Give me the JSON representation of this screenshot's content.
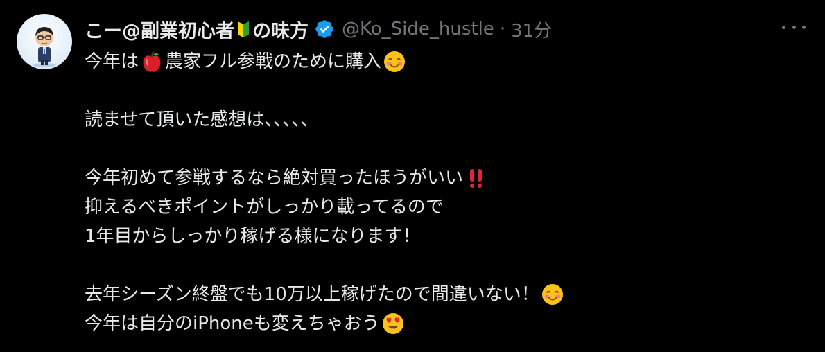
{
  "author": {
    "display_name": "こー@副業初心者",
    "name_suffix": "の味方",
    "handle": "@Ko_Side_hustle",
    "separator": "·",
    "time": "31分",
    "verified_icon": "verified-badge-icon",
    "beginner_icon": "beginner-mark-icon"
  },
  "tweet": {
    "line1_a": "今年は",
    "line1_b": "農家フル参戦のために購入",
    "line2": "読ませて頂いた感想は、、、、、",
    "line3": "今年初めて参戦するなら絶対買ったほうがいい",
    "line4": "抑えるべきポイントがしっかり載ってるので",
    "line5": "1年目からしっかり稼げる様になります！",
    "line6": "去年シーズン終盤でも10万以上稼げたので間違いない！",
    "line7": "今年は自分のiPhoneも変えちゃおう"
  },
  "colors": {
    "background": "#000000",
    "text": "#e7e9ea",
    "muted": "#71767b",
    "verified": "#1d9bf0"
  }
}
